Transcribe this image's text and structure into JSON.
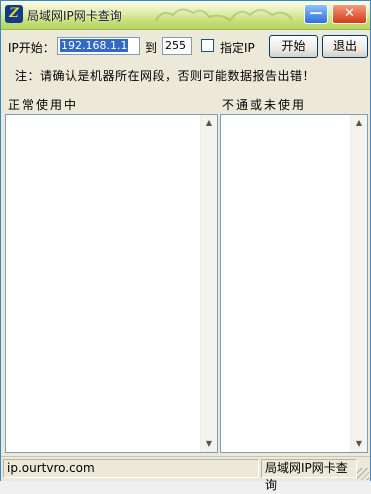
{
  "window": {
    "title": "局域网IP网卡查询",
    "icon_letter": "Z",
    "minimize_glyph": "—",
    "close_glyph": "✕"
  },
  "toolbar": {
    "ip_start_label": "IP开始：",
    "ip_start_value": "192.168.1.1",
    "to_label": "到",
    "ip_end_value": "255",
    "specify_ip_label": "指定IP",
    "specify_ip_checked": false,
    "start_button": "开始",
    "exit_button": "退出"
  },
  "note": "注：请确认是机器所在网段，否则可能数据报告出错！",
  "lists": {
    "in_use_label": "正常使用中",
    "unused_label": "不通或未使用",
    "in_use_items": [],
    "unused_items": []
  },
  "statusbar": {
    "left": "ip.ourtvro.com",
    "right": "局域网IP网卡查询"
  },
  "icons": {
    "scroll_up": "▲",
    "scroll_down": "▼"
  },
  "colors": {
    "title_gradient_top": "#fbfce9",
    "title_gradient_bottom": "#b3d55f",
    "selection": "#316ac5",
    "close_button": "#d33a16",
    "minimize_button": "#2c6fd6"
  }
}
